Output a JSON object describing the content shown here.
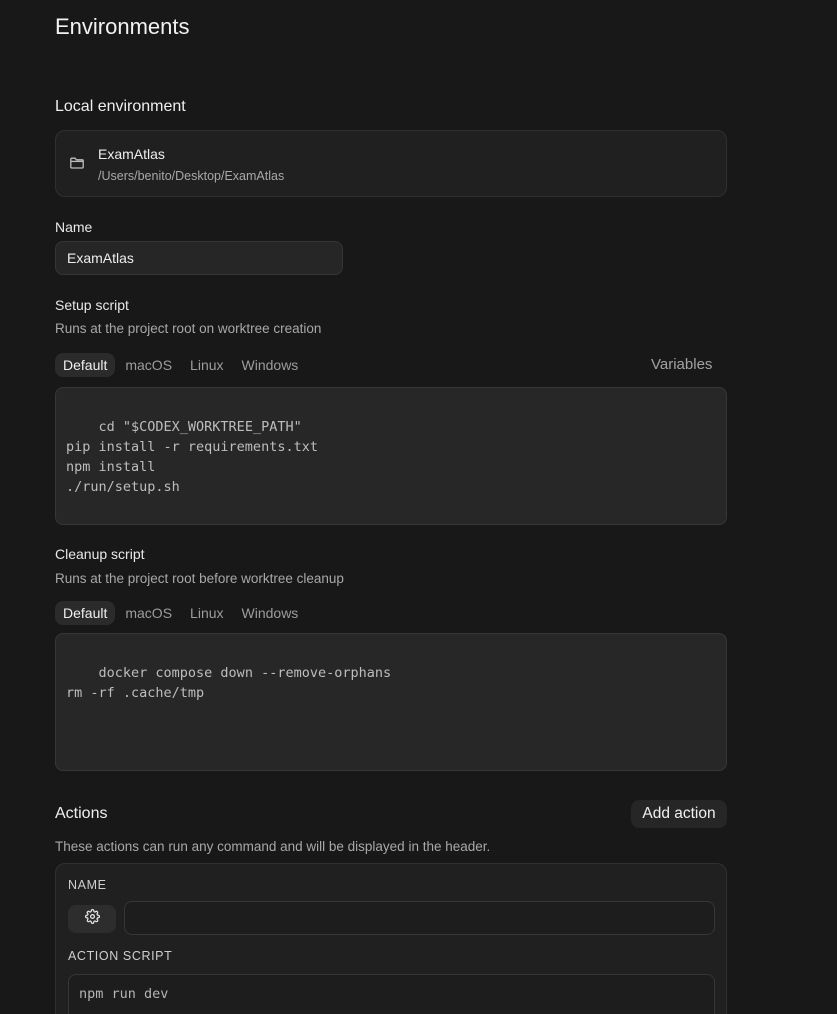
{
  "page": {
    "title": "Environments"
  },
  "local_env": {
    "heading": "Local environment",
    "project_name": "ExamAtlas",
    "project_path": "/Users/benito/Desktop/ExamAtlas"
  },
  "name_field": {
    "label": "Name",
    "value": "ExamAtlas"
  },
  "setup": {
    "label": "Setup script",
    "description": "Runs at the project root on worktree creation",
    "tabs": [
      "Default",
      "macOS",
      "Linux",
      "Windows"
    ],
    "active_tab": "Default",
    "variables_label": "Variables",
    "script": "cd \"$CODEX_WORKTREE_PATH\"\npip install -r requirements.txt\nnpm install\n./run/setup.sh"
  },
  "cleanup": {
    "label": "Cleanup script",
    "description": "Runs at the project root before worktree cleanup",
    "tabs": [
      "Default",
      "macOS",
      "Linux",
      "Windows"
    ],
    "active_tab": "Default",
    "script": "docker compose down --remove-orphans\nrm -rf .cache/tmp"
  },
  "actions": {
    "heading": "Actions",
    "add_label": "Add action",
    "description": "These actions can run any command and will be displayed in the header.",
    "name_label": "NAME",
    "name_value": "",
    "script_label": "ACTION SCRIPT",
    "script_value": "npm run dev",
    "icon": "gear-icon"
  }
}
